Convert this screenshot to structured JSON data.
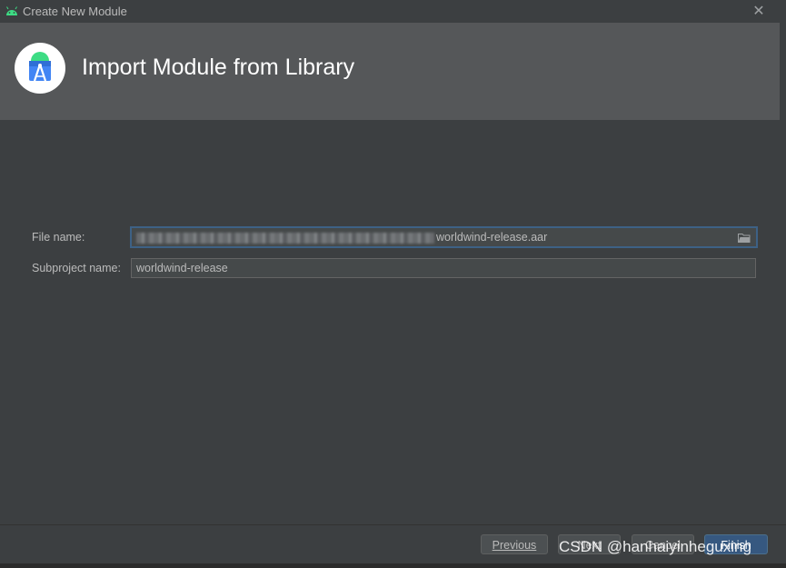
{
  "window": {
    "title": "Create New Module",
    "close_icon": "close-icon",
    "app_icon": "android-icon"
  },
  "header": {
    "title": "Import Module from Library",
    "logo_icon": "android-studio-logo"
  },
  "form": {
    "file_name_label": "File name:",
    "file_name_value": "worldwind-release.aar",
    "file_browse_icon": "folder-icon",
    "subproject_label": "Subproject name:",
    "subproject_value": "worldwind-release"
  },
  "buttons": {
    "previous_label": "Previous",
    "next_label": "Next",
    "cancel_label": "Cancel",
    "finish_label": "Finish"
  },
  "watermark": "CSDN @hanhaiyinheguxing",
  "colors": {
    "background": "#3c3f41",
    "header": "#555759",
    "accent": "#365880",
    "focus": "#3d6185"
  }
}
